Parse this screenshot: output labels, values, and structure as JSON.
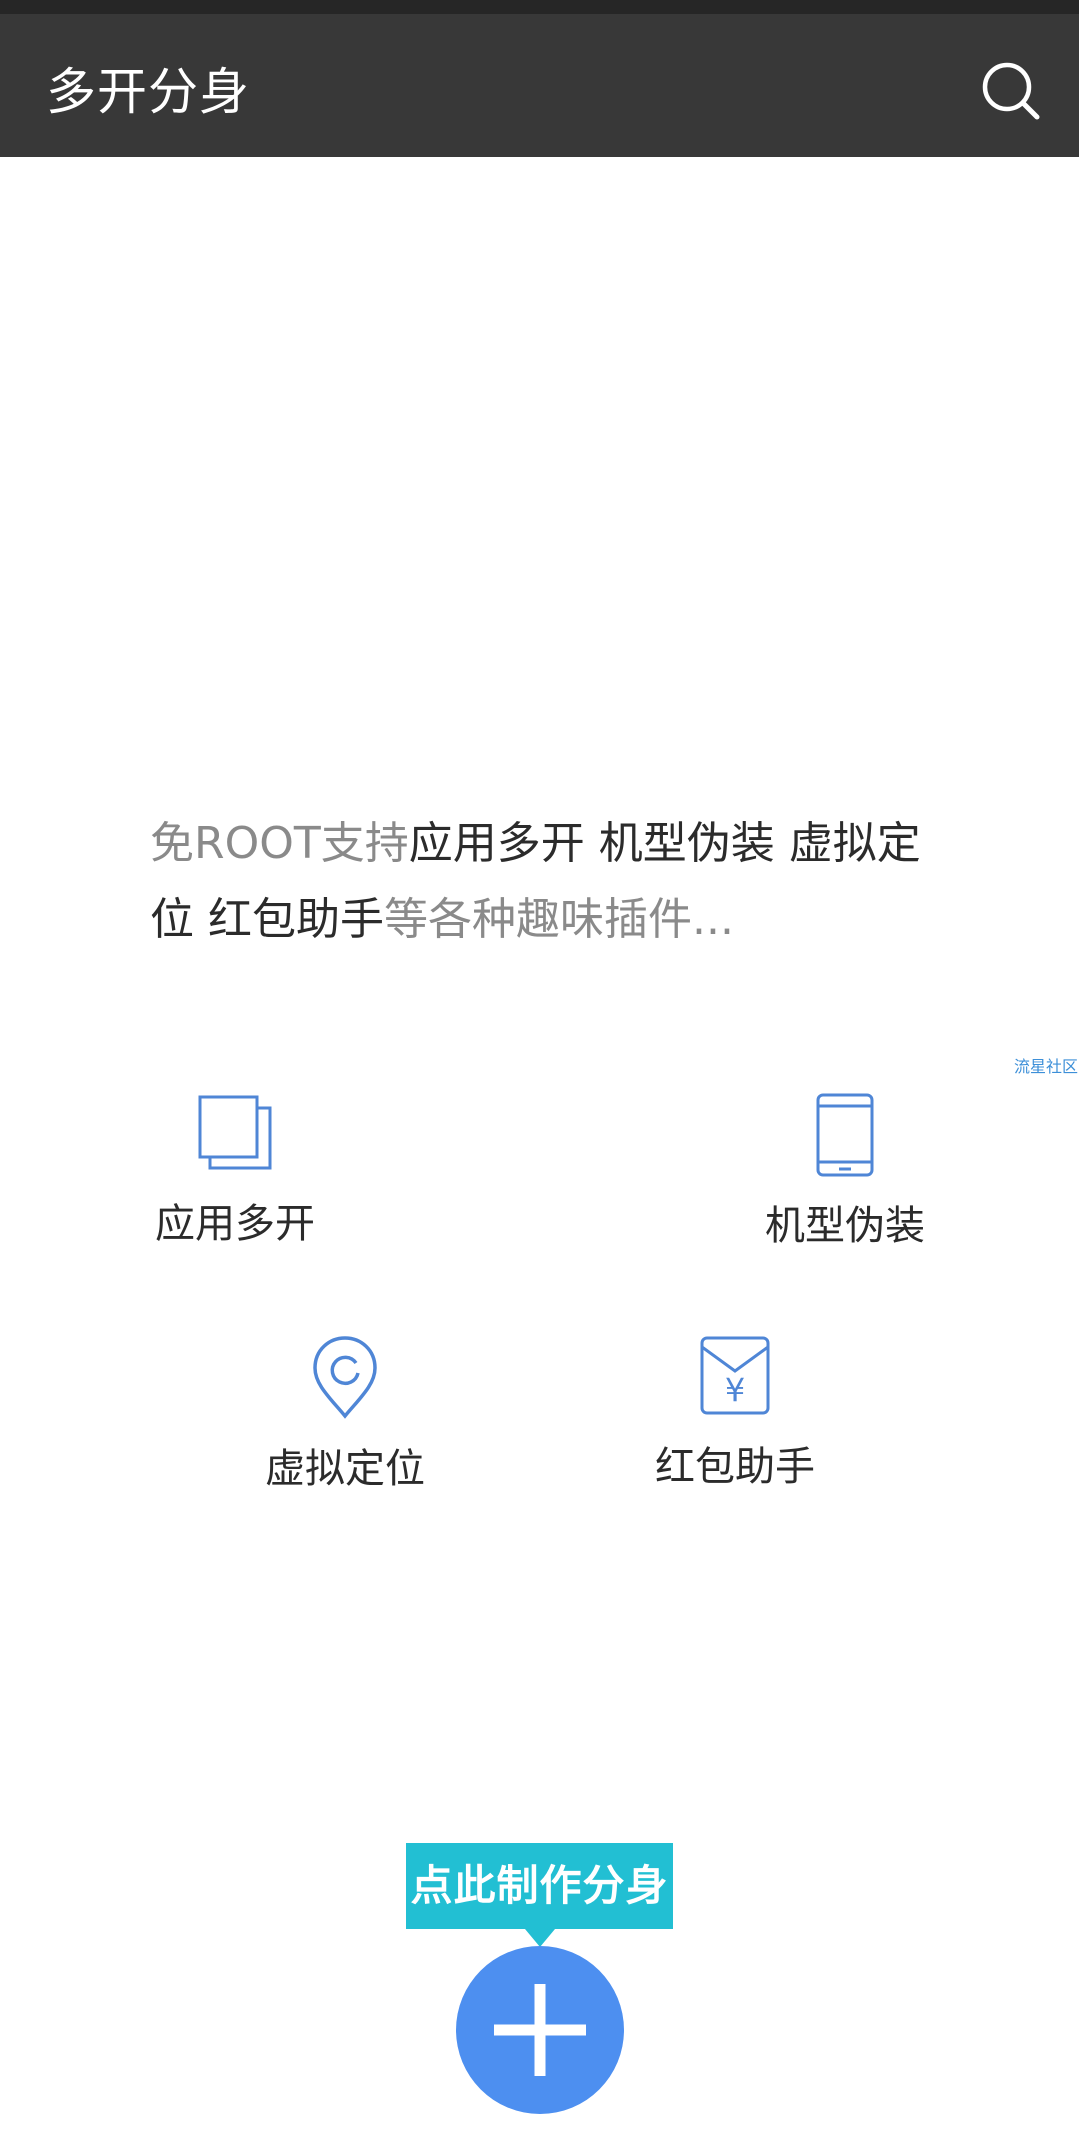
{
  "app_bar": {
    "title": "多开分身",
    "search_icon": "search-icon"
  },
  "intro": {
    "part1": "免ROOT支持",
    "part2": "应用多开 机型伪装 虚拟定位 红包助手",
    "part3": "等各种趣味插件..."
  },
  "watermark": "流星社区",
  "features": [
    {
      "label": "应用多开",
      "icon": "copy-icon"
    },
    {
      "label": "机型伪装",
      "icon": "phone-icon"
    },
    {
      "label": "虚拟定位",
      "icon": "location-pin-icon"
    },
    {
      "label": "红包助手",
      "icon": "red-envelope-icon"
    }
  ],
  "cta": {
    "tooltip": "点此制作分身",
    "fab_icon": "plus-icon"
  },
  "colors": {
    "app_bar": "#383838",
    "icon_blue": "#4f86d6",
    "fab": "#4d8ff0",
    "tooltip": "#22bfd3"
  }
}
